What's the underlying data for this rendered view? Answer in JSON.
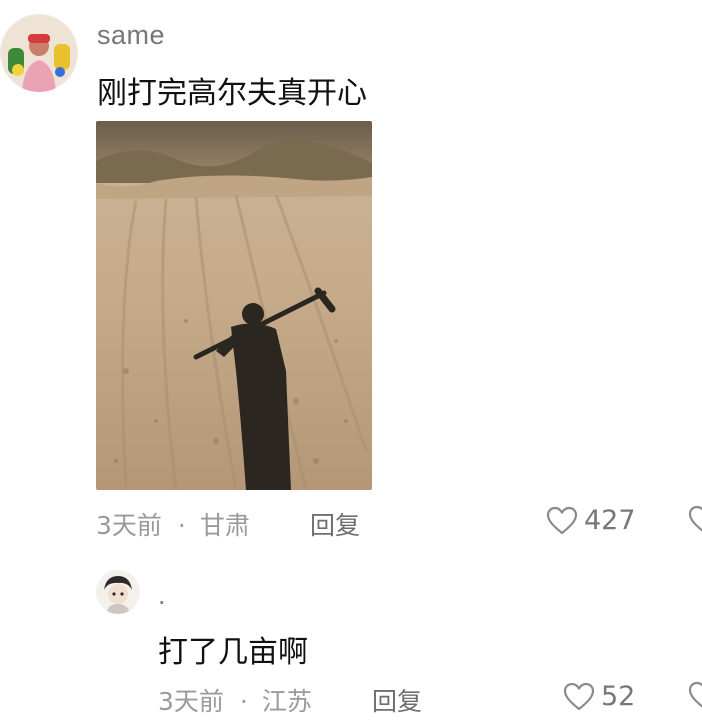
{
  "comments": [
    {
      "username": "same",
      "text": "刚打完高尔夫真开心",
      "time": "3天前",
      "separator": "·",
      "location": "甘肃",
      "reply_label": "回复",
      "likes": "427"
    },
    {
      "username": ".",
      "text": "打了几亩啊",
      "time": "3天前",
      "separator": "·",
      "location": "江苏",
      "reply_label": "回复",
      "likes": "52"
    }
  ],
  "icons": {
    "like": "heart-outline-icon"
  },
  "colors": {
    "meta_text": "#9a9a9a",
    "username": "#777777",
    "body_text": "#111111"
  }
}
